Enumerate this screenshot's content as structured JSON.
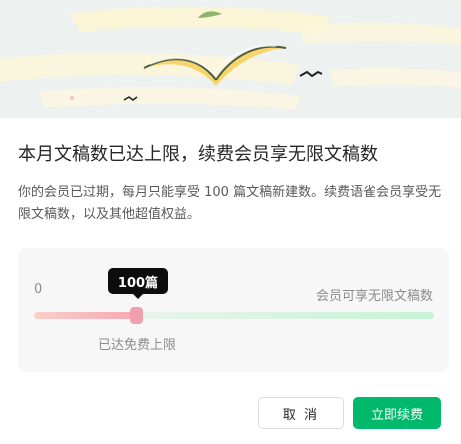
{
  "dialog": {
    "title": "本月文稿数已达上限，续费会员享无限文稿数",
    "description": "你的会员已过期，每月只能享受 100 篇文稿新建数。续费语雀会员享受无限文稿数，以及其他超值权益。"
  },
  "quota": {
    "min_label": "0",
    "max_label": "会员可享无限文稿数",
    "current_label": "100篇",
    "status_label": "已达免费上限",
    "fill_fraction": 0.26
  },
  "actions": {
    "cancel_label": "取 消",
    "renew_label": "立即续费"
  },
  "colors": {
    "accent": "#00b96b",
    "slider_used": "#f1a0b1",
    "slider_remaining": "#c6f3d6"
  },
  "illustration": {
    "icons": [
      "open-book-icon",
      "bird-icon"
    ]
  }
}
